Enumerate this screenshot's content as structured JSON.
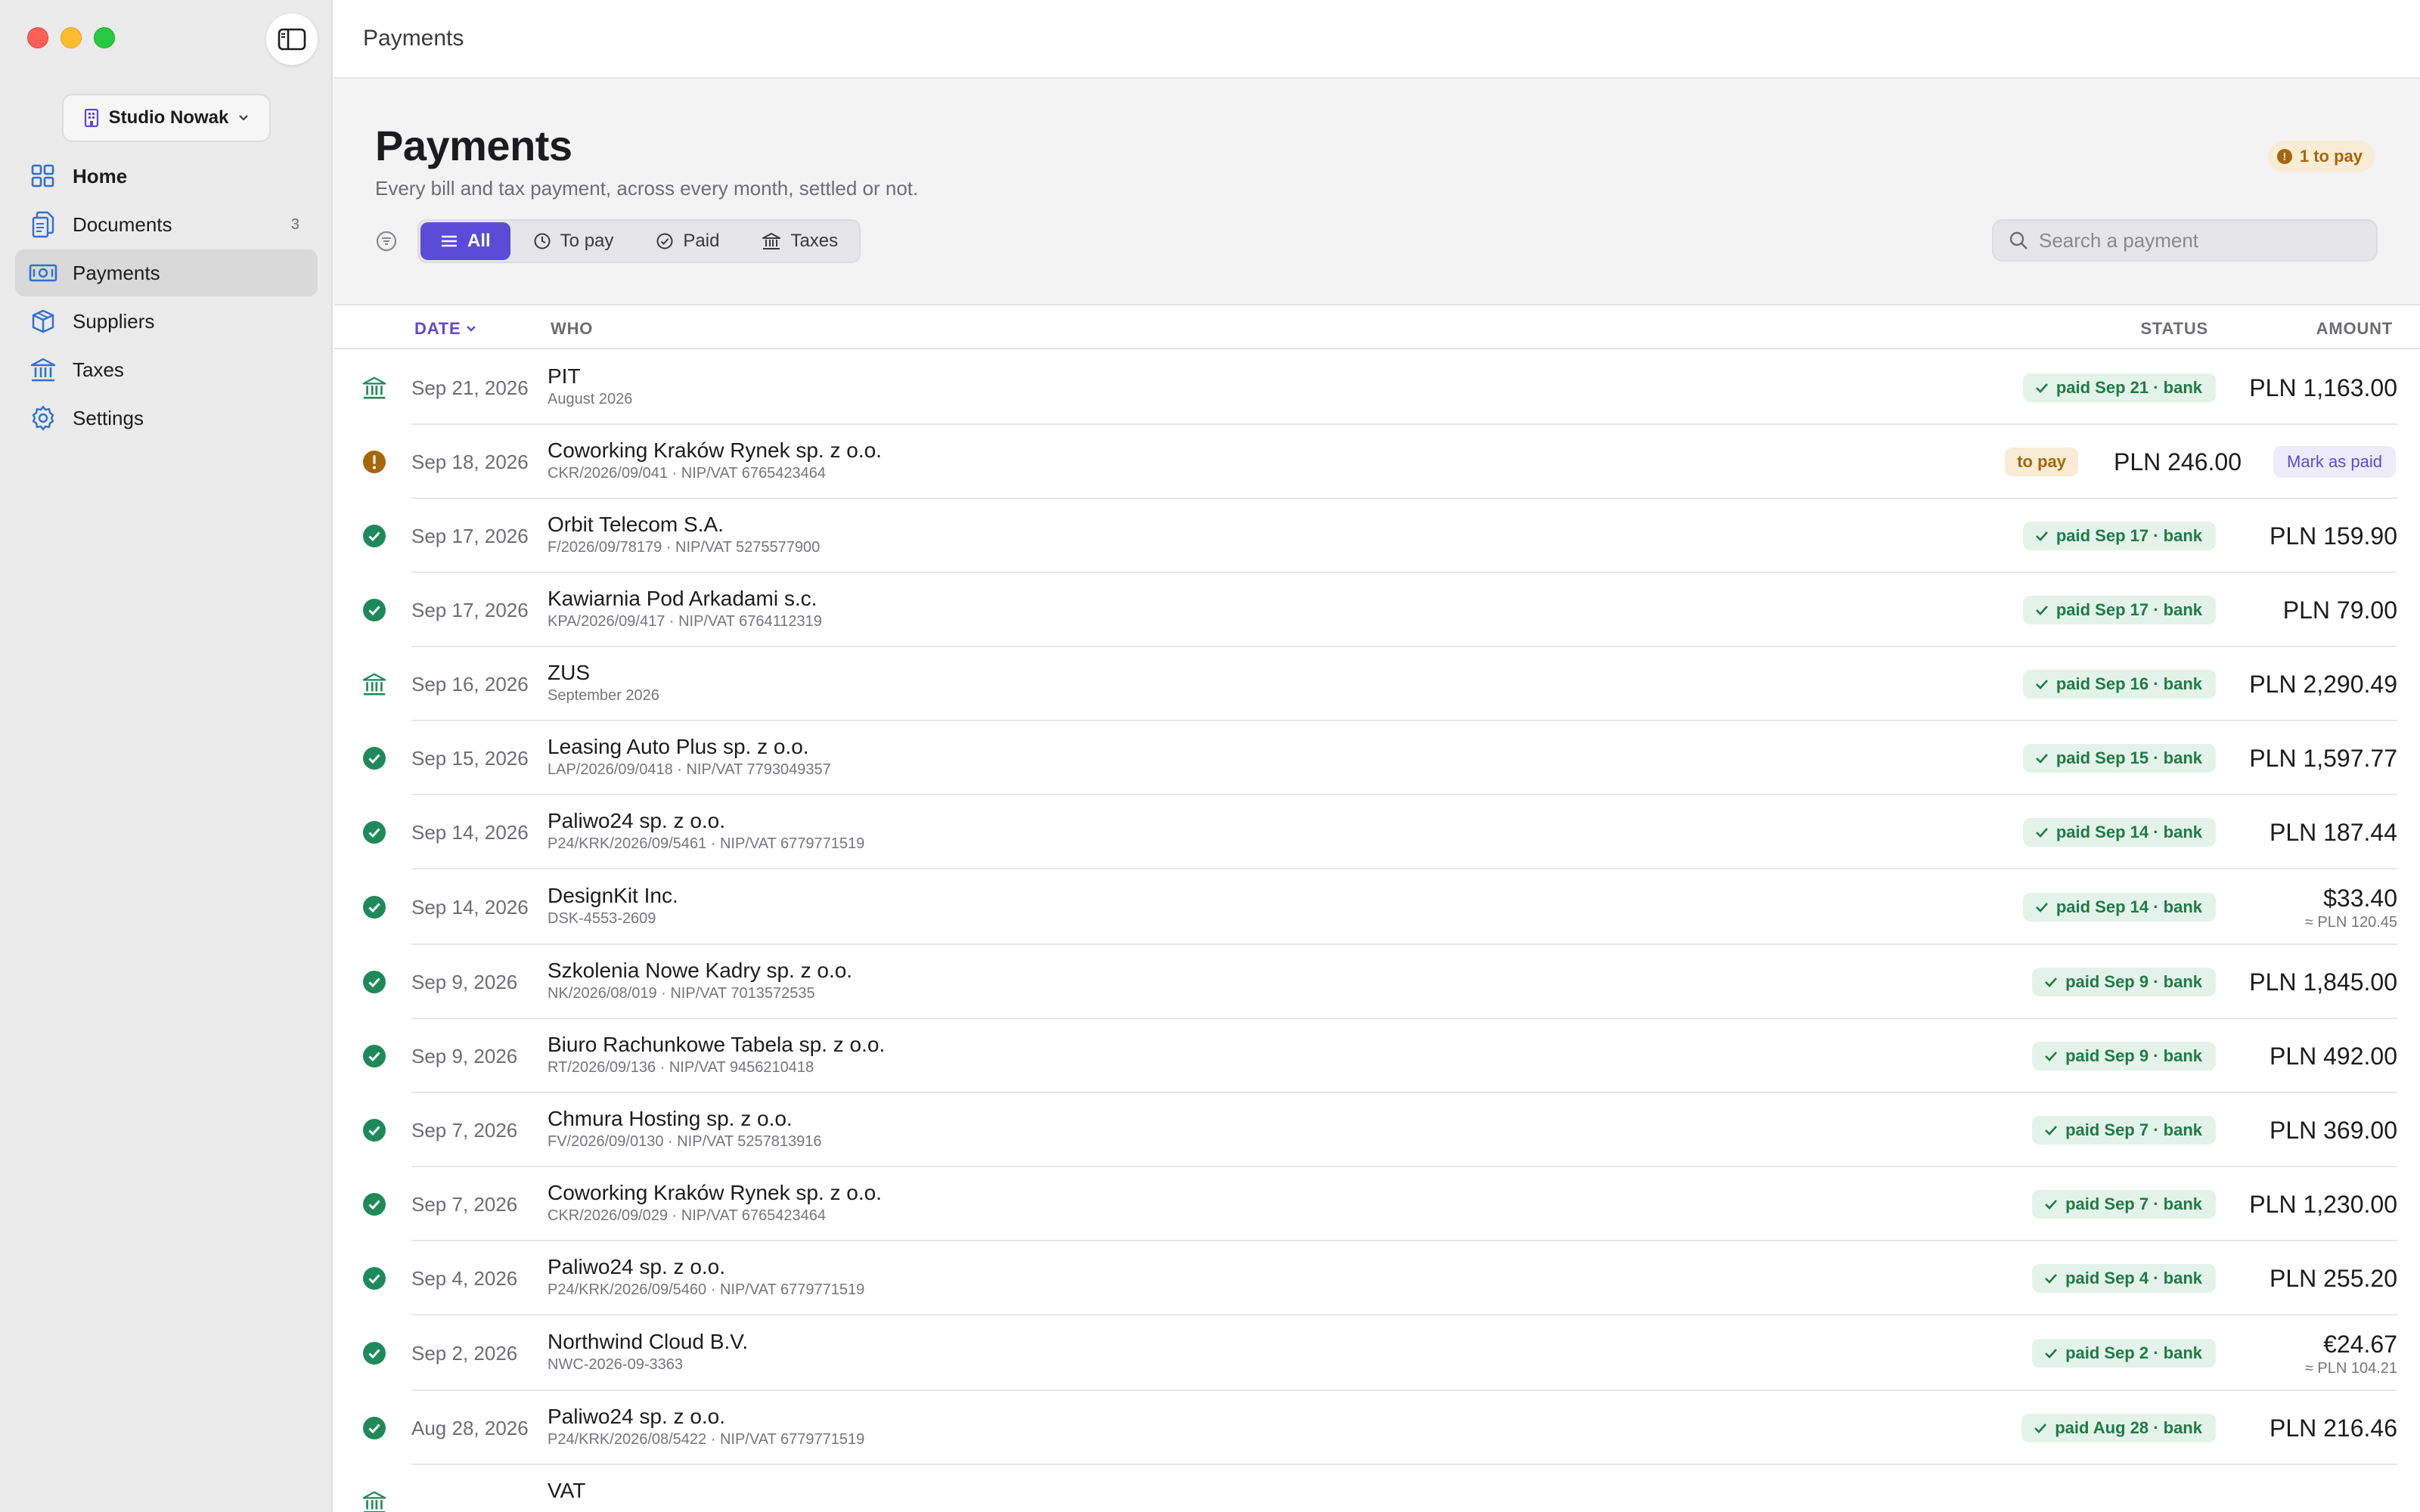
{
  "window": {
    "title": "Payments"
  },
  "sidebar": {
    "workspace": "Studio Nowak",
    "items": [
      {
        "label": "Home",
        "icon": "grid-icon",
        "badge": ""
      },
      {
        "label": "Documents",
        "icon": "documents-icon",
        "badge": "3"
      },
      {
        "label": "Payments",
        "icon": "banknote-icon",
        "badge": ""
      },
      {
        "label": "Suppliers",
        "icon": "box-icon",
        "badge": ""
      },
      {
        "label": "Taxes",
        "icon": "bank-icon",
        "badge": ""
      },
      {
        "label": "Settings",
        "icon": "gear-icon",
        "badge": ""
      }
    ]
  },
  "page": {
    "title": "Payments",
    "subtitle": "Every bill and tax payment, across every month, settled or not.",
    "to_pay_badge": "1 to pay"
  },
  "filters": {
    "tabs": [
      {
        "label": "All",
        "icon": "list-icon",
        "active": true
      },
      {
        "label": "To pay",
        "icon": "clock-icon",
        "active": false
      },
      {
        "label": "Paid",
        "icon": "check-circle-icon",
        "active": false
      },
      {
        "label": "Taxes",
        "icon": "bank-icon",
        "active": false
      }
    ],
    "search_placeholder": "Search a payment"
  },
  "table": {
    "columns": {
      "date": "DATE",
      "who": "WHO",
      "status": "STATUS",
      "amount": "AMOUNT"
    },
    "mark_paid_label": "Mark as paid",
    "rows": [
      {
        "icon": "bank-icon",
        "date": "Sep 21, 2026",
        "name": "PIT",
        "ref": "August 2026",
        "status": "paid Sep 21 · bank",
        "status_type": "paid",
        "amount": "PLN 1,163.00",
        "converted": ""
      },
      {
        "icon": "warning-icon",
        "date": "Sep 18, 2026",
        "name": "Coworking Kraków Rynek sp. z o.o.",
        "ref": "CKR/2026/09/041 · NIP/VAT 6765423464",
        "status": "to pay",
        "status_type": "topay",
        "amount": "PLN 246.00",
        "converted": ""
      },
      {
        "icon": "check-circle-icon",
        "date": "Sep 17, 2026",
        "name": "Orbit Telecom S.A.",
        "ref": "F/2026/09/78179 · NIP/VAT 5275577900",
        "status": "paid Sep 17 · bank",
        "status_type": "paid",
        "amount": "PLN 159.90",
        "converted": ""
      },
      {
        "icon": "check-circle-icon",
        "date": "Sep 17, 2026",
        "name": "Kawiarnia Pod Arkadami s.c.",
        "ref": "KPA/2026/09/417 · NIP/VAT 6764112319",
        "status": "paid Sep 17 · bank",
        "status_type": "paid",
        "amount": "PLN 79.00",
        "converted": ""
      },
      {
        "icon": "bank-icon",
        "date": "Sep 16, 2026",
        "name": "ZUS",
        "ref": "September 2026",
        "status": "paid Sep 16 · bank",
        "status_type": "paid",
        "amount": "PLN 2,290.49",
        "converted": ""
      },
      {
        "icon": "check-circle-icon",
        "date": "Sep 15, 2026",
        "name": "Leasing Auto Plus sp. z o.o.",
        "ref": "LAP/2026/09/0418 · NIP/VAT 7793049357",
        "status": "paid Sep 15 · bank",
        "status_type": "paid",
        "amount": "PLN 1,597.77",
        "converted": ""
      },
      {
        "icon": "check-circle-icon",
        "date": "Sep 14, 2026",
        "name": "Paliwo24 sp. z o.o.",
        "ref": "P24/KRK/2026/09/5461 · NIP/VAT 6779771519",
        "status": "paid Sep 14 · bank",
        "status_type": "paid",
        "amount": "PLN 187.44",
        "converted": ""
      },
      {
        "icon": "check-circle-icon",
        "date": "Sep 14, 2026",
        "name": "DesignKit Inc.",
        "ref": "DSK-4553-2609",
        "status": "paid Sep 14 · bank",
        "status_type": "paid",
        "amount": "$33.40",
        "converted": "≈ PLN 120.45"
      },
      {
        "icon": "check-circle-icon",
        "date": "Sep 9, 2026",
        "name": "Szkolenia Nowe Kadry sp. z o.o.",
        "ref": "NK/2026/08/019 · NIP/VAT 7013572535",
        "status": "paid Sep 9 · bank",
        "status_type": "paid",
        "amount": "PLN 1,845.00",
        "converted": ""
      },
      {
        "icon": "check-circle-icon",
        "date": "Sep 9, 2026",
        "name": "Biuro Rachunkowe Tabela sp. z o.o.",
        "ref": "RT/2026/09/136 · NIP/VAT 9456210418",
        "status": "paid Sep 9 · bank",
        "status_type": "paid",
        "amount": "PLN 492.00",
        "converted": ""
      },
      {
        "icon": "check-circle-icon",
        "date": "Sep 7, 2026",
        "name": "Chmura Hosting sp. z o.o.",
        "ref": "FV/2026/09/0130 · NIP/VAT 5257813916",
        "status": "paid Sep 7 · bank",
        "status_type": "paid",
        "amount": "PLN 369.00",
        "converted": ""
      },
      {
        "icon": "check-circle-icon",
        "date": "Sep 7, 2026",
        "name": "Coworking Kraków Rynek sp. z o.o.",
        "ref": "CKR/2026/09/029 · NIP/VAT 6765423464",
        "status": "paid Sep 7 · bank",
        "status_type": "paid",
        "amount": "PLN 1,230.00",
        "converted": ""
      },
      {
        "icon": "check-circle-icon",
        "date": "Sep 4, 2026",
        "name": "Paliwo24 sp. z o.o.",
        "ref": "P24/KRK/2026/09/5460 · NIP/VAT 6779771519",
        "status": "paid Sep 4 · bank",
        "status_type": "paid",
        "amount": "PLN 255.20",
        "converted": ""
      },
      {
        "icon": "check-circle-icon",
        "date": "Sep 2, 2026",
        "name": "Northwind Cloud B.V.",
        "ref": "NWC-2026-09-3363",
        "status": "paid Sep 2 · bank",
        "status_type": "paid",
        "amount": "€24.67",
        "converted": "≈ PLN 104.21"
      },
      {
        "icon": "check-circle-icon",
        "date": "Aug 28, 2026",
        "name": "Paliwo24 sp. z o.o.",
        "ref": "P24/KRK/2026/08/5422 · NIP/VAT 6779771519",
        "status": "paid Aug 28 · bank",
        "status_type": "paid",
        "amount": "PLN 216.46",
        "converted": ""
      },
      {
        "icon": "bank-icon",
        "date": "",
        "name": "VAT",
        "ref": "",
        "status": "",
        "status_type": "paid",
        "amount": "",
        "converted": ""
      }
    ]
  },
  "colors": {
    "accent": "#5b4bd6",
    "paid_green": "#1f7a47",
    "paid_bg": "#e4f3ea",
    "warn": "#a6660a",
    "warn_bg": "#f8ecd4",
    "icon_green": "#1e8a5a",
    "icon_blue": "#2f6fd6"
  }
}
